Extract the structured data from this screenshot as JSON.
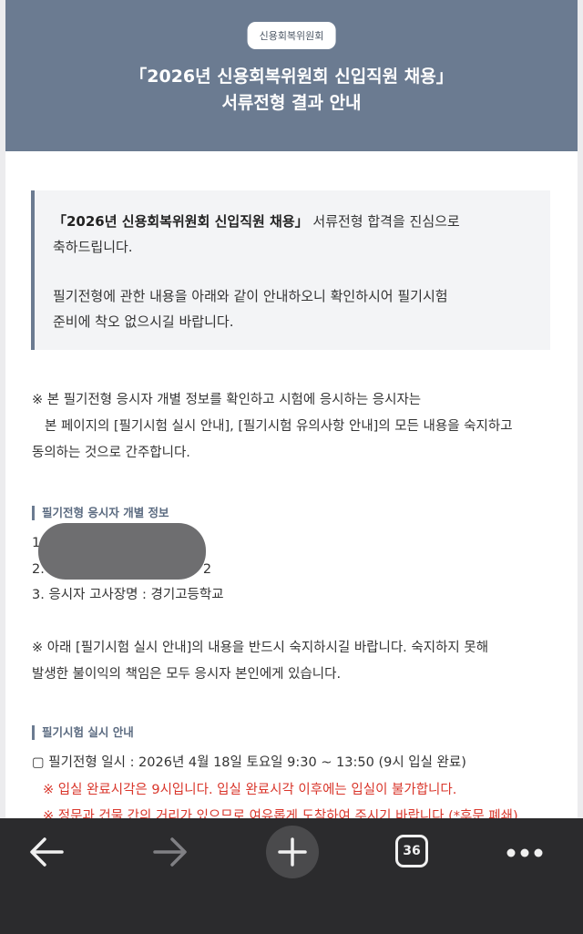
{
  "header": {
    "badge": "신용회복위원회",
    "title_line1": "「2026년 신용회복위원회 신입직원 채용」",
    "title_line2": "서류전형 결과 안내"
  },
  "notice": {
    "bold_part": "「2026년 신용회복위원회 신입직원 채용」",
    "line1_rest": " 서류전형 합격을 진심으로",
    "line2": "축하드립니다.",
    "para2_line1": "필기전형에 관한 내용을 아래와 같이 안내하오니 확인하시어 필기시험",
    "para2_line2": "준비에 착오 없으시길 바랍니다."
  },
  "consent": {
    "line1": "※ 본 필기전형 응시자 개별 정보를 확인하고 시험에 응시하는 응시자는",
    "line2": "본 페이지의 [필기시험 실시 안내], [필기시험 유의사항 안내]의 모든 내용을 숙지하고",
    "line3": "동의하는 것으로 간주합니다."
  },
  "individual_info": {
    "heading": "필기전형 응시자 개별 정보",
    "item1_prefix": "1",
    "item2_prefix": "2.",
    "item2_suffix": "2",
    "item3": "3. 응시자 고사장명 : 경기고등학교"
  },
  "warning": {
    "line1": "※ 아래 [필기시험 실시 안내]의 내용을 반드시 숙지하시길 바랍니다. 숙지하지 못해",
    "line2": "발생한 불이익의 책임은 모두 응시자 본인에게 있습니다."
  },
  "exam_info": {
    "heading": "필기시험 실시 안내",
    "datetime": "▢ 필기전형 일시 : 2026년 4월 18일 토요일 9:30 ~ 13:50 (9시 입실 완료)",
    "note1": "※ 입실 완료시각은 9시입니다. 입실 완료시각 이후에는 입실이 불가합니다.",
    "note2": "※ 정문과 건물 간의 거리가 있으므로 여유롭게 도착하여 주시기 바랍니다 (*후문 폐쇄)"
  },
  "toolbar": {
    "tab_count": "36",
    "back_icon": "back-arrow-icon",
    "forward_icon": "forward-arrow-icon",
    "new_tab_icon": "plus-icon",
    "more_icon": "more-dots-icon"
  }
}
